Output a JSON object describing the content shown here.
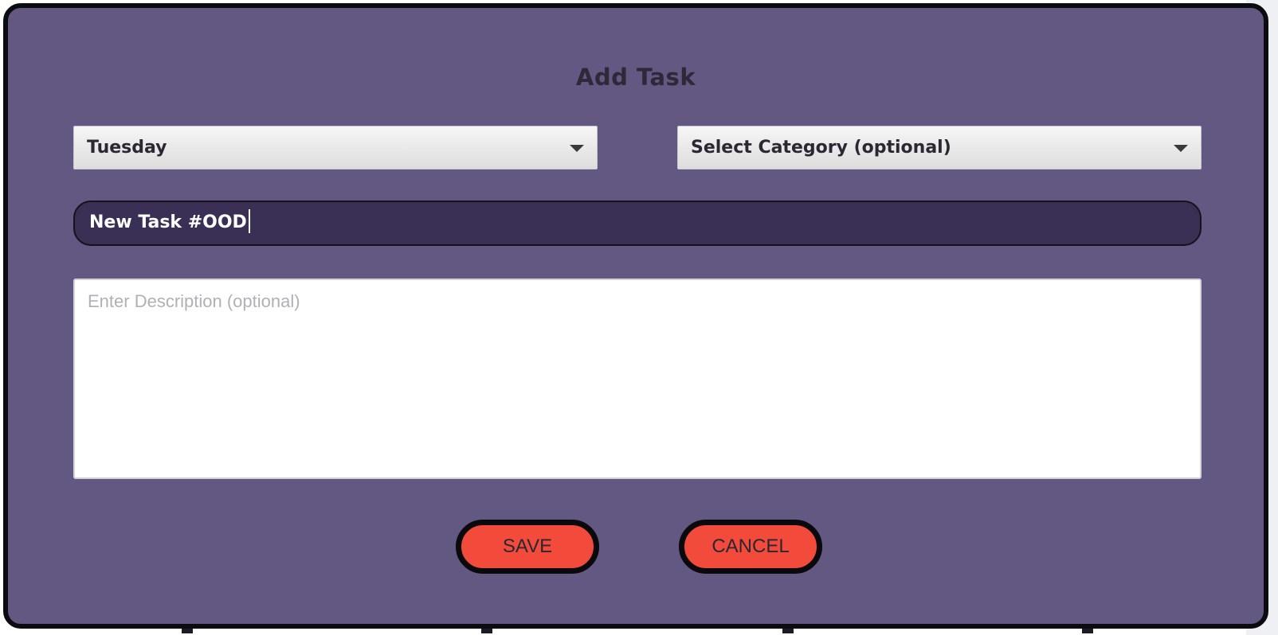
{
  "dialog": {
    "title": "Add Task"
  },
  "day_select": {
    "selected": "Tuesday"
  },
  "category_select": {
    "selected": "Select Category (optional)"
  },
  "task_title": {
    "value": "New Task #OOD"
  },
  "description": {
    "placeholder": "Enter Description (optional)",
    "value": ""
  },
  "buttons": {
    "save_label": "SAVE",
    "cancel_label": "CANCEL"
  },
  "colors": {
    "dialog_bg": "#625882",
    "input_bg": "#3a2f54",
    "button_bg": "#f24b3c"
  },
  "icons": {
    "dropdown": "caret-down-icon"
  }
}
